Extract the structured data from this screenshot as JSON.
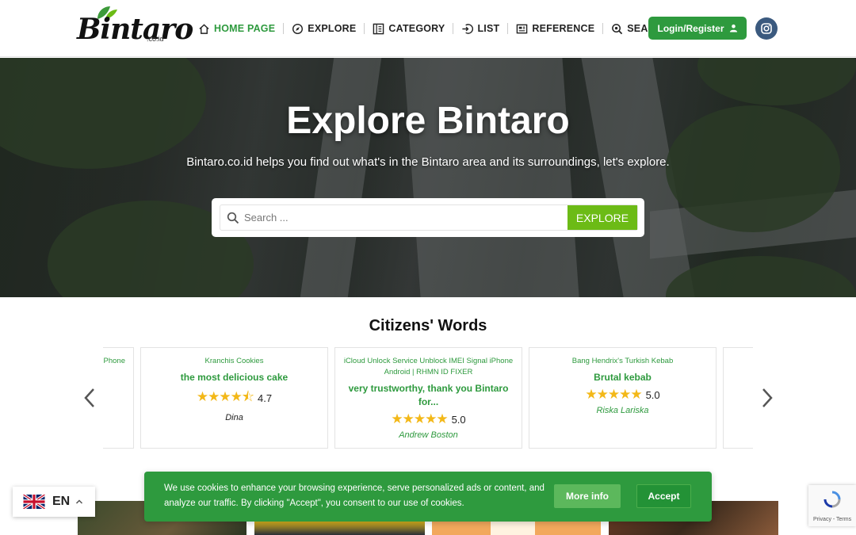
{
  "header": {
    "logo_text": "Bintaro",
    "logo_sub": ".co.id",
    "nav": [
      {
        "label": "HOME PAGE",
        "icon": "home-icon",
        "active": true
      },
      {
        "label": "EXPLORE",
        "icon": "compass-icon"
      },
      {
        "label": "CATEGORY",
        "icon": "category-icon"
      },
      {
        "label": "LIST",
        "icon": "list-login-icon"
      },
      {
        "label": "REFERENCE",
        "icon": "newspaper-icon"
      },
      {
        "label": "SEARCH",
        "icon": "search-icon"
      }
    ],
    "login_label": "Login/Register",
    "social_icon": "instagram-icon"
  },
  "hero": {
    "title": "Explore Bintaro",
    "subtitle": "Bintaro.co.id helps you find out what's in the Bintaro area and its surroundings, let's explore.",
    "search_placeholder": "Search ...",
    "explore_label": "EXPLORE"
  },
  "testimonials": {
    "title": "Citizens' Words",
    "cards": [
      {
        "place": "Phone",
        "quote": "",
        "rating": "",
        "author": ""
      },
      {
        "place": "Kranchis Cookies",
        "quote": "the most delicious cake",
        "stars": "★★★★⯪",
        "rating": "4.7",
        "author": "Dina"
      },
      {
        "place": "iCloud Unlock Service Unblock IMEI Signal iPhone Android | RHMN ID FIXER",
        "quote": "very trustworthy, thank you Bintaro for...",
        "stars": "★★★★★",
        "rating": "5.0",
        "author": "Andrew Boston"
      },
      {
        "place": "Bang Hendrix's Turkish Kebab",
        "quote": "Brutal kebab",
        "stars": "★★★★★",
        "rating": "5.0",
        "author": "Riska Lariska"
      }
    ]
  },
  "cookie": {
    "text": "We use cookies to enhance your browsing experience, serve personalized ads or content, and analyze our traffic. By clicking \"Accept\", you consent to our use of cookies.",
    "more_label": "More info",
    "accept_label": "Accept"
  },
  "language": {
    "code": "EN"
  },
  "recaptcha": {
    "links": "Privacy - Terms"
  },
  "colors": {
    "brand_green": "#2e9a3e",
    "explore_green": "#6cbb16",
    "star": "#f3b818"
  }
}
